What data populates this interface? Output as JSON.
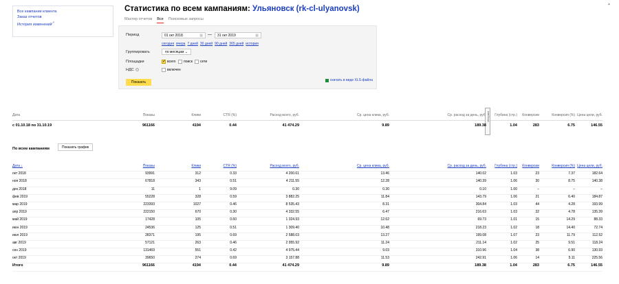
{
  "nav": {
    "links": [
      "Все кампании клиента",
      "Заказ отчетов",
      "История изменений"
    ]
  },
  "title": {
    "prefix": "Статистика по всем кампаниям:",
    "campaign": "Ульяновск (rk-cl-ulyanovsk)"
  },
  "tabs": [
    "Мастер отчетов",
    "Все",
    "Поисковые запросы"
  ],
  "filter": {
    "period_label": "Период",
    "date_from": "01 окт 2018",
    "date_to": "31 окт 2019",
    "quick_links": [
      "сегодня",
      "вчера",
      "7 дней",
      "30 дней",
      "90 дней",
      "365 дней",
      "история"
    ],
    "group_label": "Группировать",
    "group_value": "по месяцам",
    "platform_label": "Площадки",
    "platforms": [
      "всего",
      "поиск",
      "сети"
    ],
    "vat_label": "НДС",
    "vat_option": "включен",
    "show_button": "Показать",
    "xls_link": "скачать в виде XLS-файла"
  },
  "summary": {
    "headers": [
      "Дата",
      "Показы",
      "Клики",
      "CTR (%)",
      "Расход всего, руб.",
      "Ср. цена клика, руб.",
      "Ср. расход за день, руб.",
      "Глубина (стр.)",
      "Конверсии",
      "Конверсия (%)",
      "Цена цели, руб."
    ],
    "vertical_label": "Метрика",
    "row": [
      "с 01.10.18 по 31.10.19",
      "961166",
      "4194",
      "0.44",
      "41 474.29",
      "9.89",
      "189.38",
      "1.04",
      "283",
      "6.75",
      "146.55"
    ]
  },
  "detail": {
    "title": "По всем кампаниям",
    "graph_button": "Показать график",
    "headers": [
      "Дата ↓",
      "Показы",
      "Клики",
      "CTR (%)",
      "Расход всего, руб.",
      "Ср. цена клика, руб.",
      "Ср. расход за день, руб.",
      "Глубина (стр.)",
      "Конверсии",
      "Конверсия (%)",
      "Цена цели, руб."
    ],
    "rows": [
      [
        "окт 2018",
        "93991",
        "312",
        "0.33",
        "4 200.61",
        "13.46",
        "140.02",
        "1.03",
        "23",
        "7.37",
        "182.64"
      ],
      [
        "ноя 2018",
        "67818",
        "343",
        "0.51",
        "4 211.55",
        "12.28",
        "140.39",
        "1.06",
        "30",
        "8.75",
        "140.38"
      ],
      [
        "дек 2018",
        "11",
        "1",
        "9.09",
        "0.30",
        "0.30",
        "0.10",
        "1.00",
        "–",
        "–",
        "–"
      ],
      [
        "фев 2019",
        "55228",
        "328",
        "0.59",
        "3 882.25",
        "11.84",
        "143.79",
        "1.06",
        "21",
        "6.40",
        "184.87"
      ],
      [
        "мар 2019",
        "223393",
        "1027",
        "0.46",
        "8 535.43",
        "8.31",
        "304.84",
        "1.03",
        "44",
        "4.28",
        "193.99"
      ],
      [
        "апр 2019",
        "222150",
        "670",
        "0.30",
        "4 332.55",
        "6.47",
        "216.63",
        "1.03",
        "32",
        "4.78",
        "135.39"
      ],
      [
        "май 2019",
        "17428",
        "105",
        "0.60",
        "1 324.93",
        "12.62",
        "69.73",
        "1.01",
        "15",
        "14.29",
        "88.33"
      ],
      [
        "июн 2019",
        "24536",
        "125",
        "0.51",
        "1 309.40",
        "10.48",
        "218.23",
        "1.02",
        "18",
        "14.40",
        "72.74"
      ],
      [
        "июл 2019",
        "28371",
        "195",
        "0.69",
        "2 588.03",
        "13.27",
        "199.08",
        "1.07",
        "23",
        "11.79",
        "112.52"
      ],
      [
        "авг 2019",
        "57121",
        "263",
        "0.46",
        "2 955.92",
        "11.24",
        "211.14",
        "1.02",
        "25",
        "9.51",
        "118.24"
      ],
      [
        "сен 2019",
        "131469",
        "551",
        "0.42",
        "4 975.44",
        "9.03",
        "310.96",
        "1.04",
        "38",
        "6.90",
        "130.93"
      ],
      [
        "окт 2019",
        "39650",
        "274",
        "0.69",
        "3 157.88",
        "11.53",
        "242.91",
        "1.06",
        "14",
        "5.11",
        "225.56"
      ]
    ],
    "total": [
      "Итого",
      "961166",
      "4194",
      "0.44",
      "41 474.29",
      "9.89",
      "189.38",
      "1.04",
      "283",
      "6.75",
      "146.55"
    ]
  }
}
